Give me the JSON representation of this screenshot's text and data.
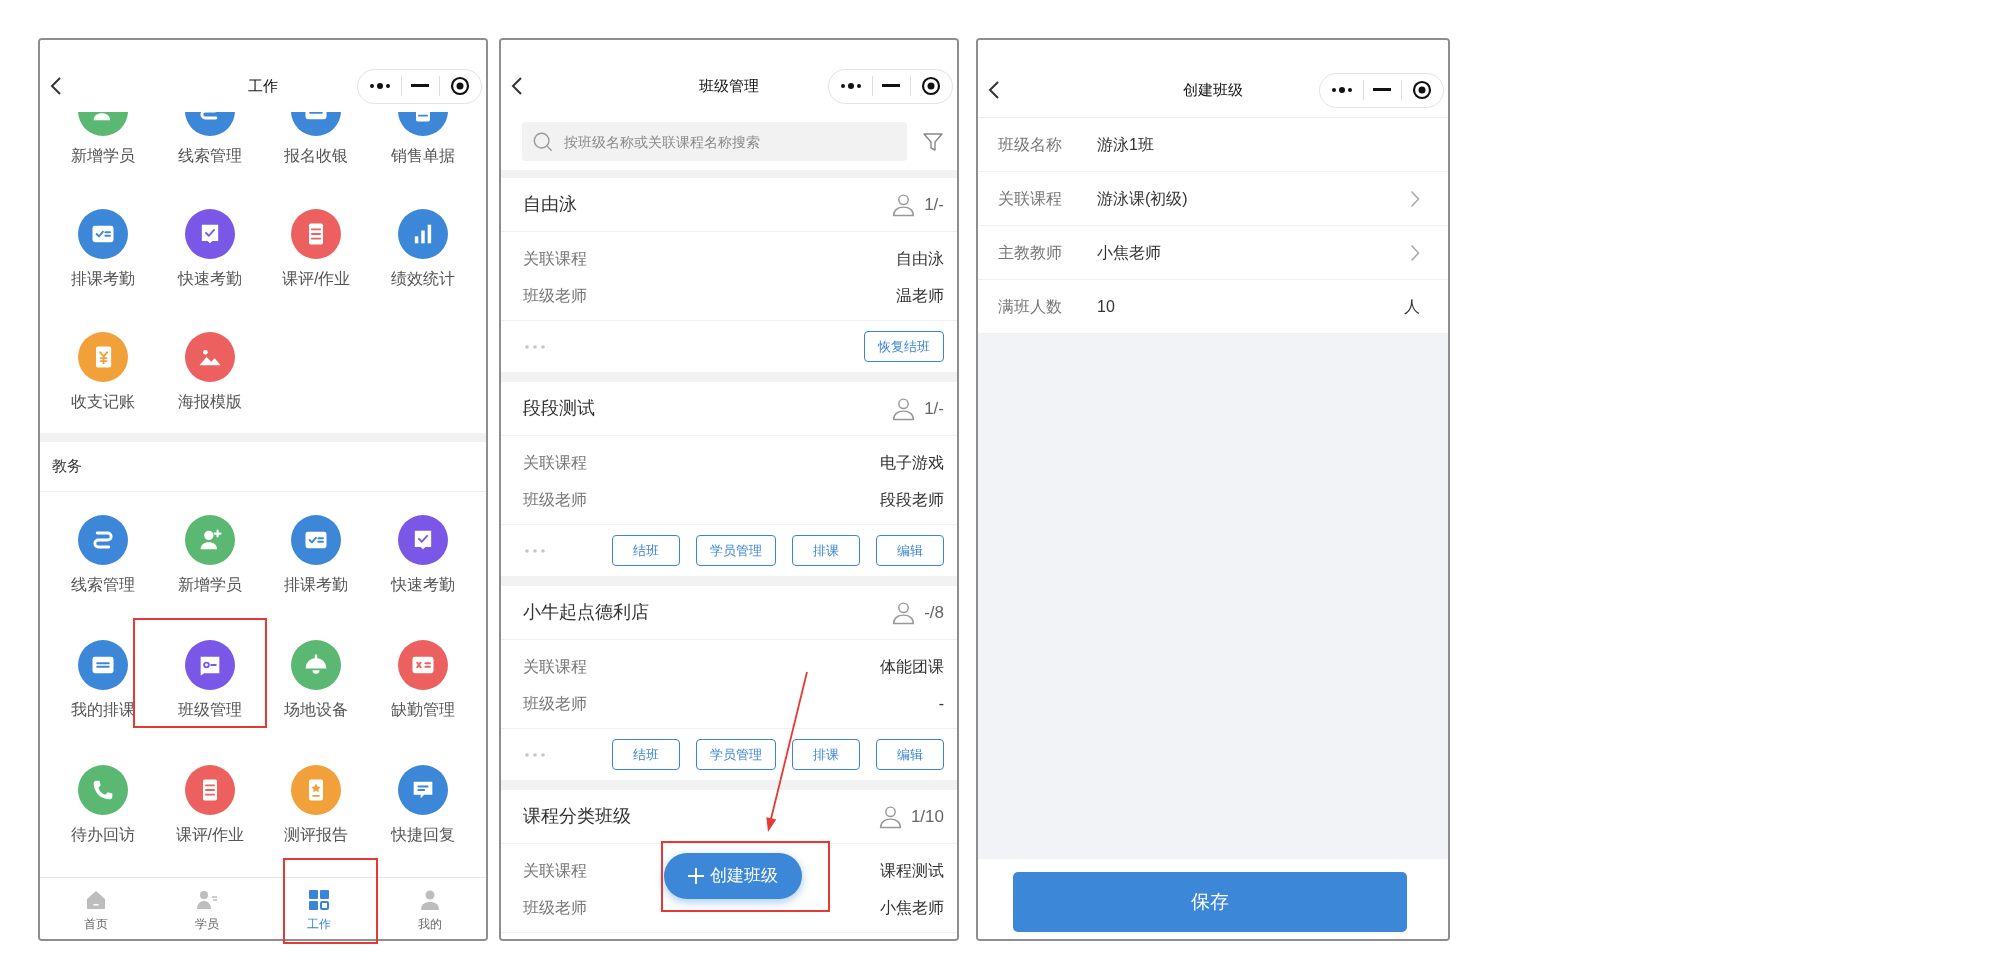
{
  "work_screen": {
    "title": "工作",
    "sections": [
      {
        "items": [
          {
            "label": "新增学员",
            "color": "#5bb872"
          },
          {
            "label": "线索管理",
            "color": "#3d87d9"
          },
          {
            "label": "报名收银",
            "color": "#3d87d9"
          },
          {
            "label": "销售单据",
            "color": "#3d87d9"
          },
          {
            "label": "排课考勤",
            "color": "#3d87d9"
          },
          {
            "label": "快速考勤",
            "color": "#7b57e8"
          },
          {
            "label": "课评/作业",
            "color": "#ec6160"
          },
          {
            "label": "绩效统计",
            "color": "#3d87d9"
          },
          {
            "label": "收支记账",
            "color": "#f2a03a"
          },
          {
            "label": "海报模版",
            "color": "#ec6160"
          }
        ]
      },
      {
        "title": "教务",
        "items": [
          {
            "label": "线索管理",
            "color": "#3d87d9"
          },
          {
            "label": "新增学员",
            "color": "#5bb872"
          },
          {
            "label": "排课考勤",
            "color": "#3d87d9"
          },
          {
            "label": "快速考勤",
            "color": "#7b57e8"
          },
          {
            "label": "我的排课",
            "color": "#3d87d9"
          },
          {
            "label": "班级管理",
            "color": "#7b57e8"
          },
          {
            "label": "场地设备",
            "color": "#5bb872"
          },
          {
            "label": "缺勤管理",
            "color": "#ec6160"
          },
          {
            "label": "待办回访",
            "color": "#5bb872"
          },
          {
            "label": "课评/作业",
            "color": "#ec6160"
          },
          {
            "label": "测评报告",
            "color": "#f2a03a"
          },
          {
            "label": "快捷回复",
            "color": "#3d87d9"
          }
        ]
      }
    ],
    "tab_bar": [
      {
        "label": "首页",
        "selected": false
      },
      {
        "label": "学员",
        "selected": false
      },
      {
        "label": "工作",
        "selected": true
      },
      {
        "label": "我的",
        "selected": false
      }
    ]
  },
  "class_screen": {
    "title": "班级管理",
    "search": {
      "placeholder": "按班级名称或关联课程名称搜索"
    },
    "classes": [
      {
        "name": "自由泳",
        "count": "1/-",
        "course_label": "关联课程",
        "course": "自由泳",
        "teacher_label": "班级老师",
        "teacher": "温老师",
        "actions": [
          "恢复结班"
        ]
      },
      {
        "name": "段段测试",
        "count": "1/-",
        "course_label": "关联课程",
        "course": "电子游戏",
        "teacher_label": "班级老师",
        "teacher": "段段老师",
        "actions": [
          "结班",
          "学员管理",
          "排课",
          "编辑"
        ]
      },
      {
        "name": "小牛起点德利店",
        "count": "-/8",
        "course_label": "关联课程",
        "course": "体能团课",
        "teacher_label": "班级老师",
        "teacher": "-",
        "actions": [
          "结班",
          "学员管理",
          "排课",
          "编辑"
        ]
      },
      {
        "name": "课程分类班级",
        "count": "1/10",
        "course_label": "关联课程",
        "course": "课程测试",
        "teacher_label": "班级老师",
        "teacher": "小焦老师"
      }
    ],
    "create_button": "创建班级"
  },
  "create_screen": {
    "title": "创建班级",
    "fields": [
      {
        "kind": "text",
        "label": "班级名称",
        "value": "游泳1班"
      },
      {
        "kind": "select",
        "label": "关联课程",
        "value": "游泳课(初级)"
      },
      {
        "kind": "select",
        "label": "主教教师",
        "value": "小焦老师"
      },
      {
        "kind": "number",
        "label": "满班人数",
        "value": "10",
        "unit": "人"
      }
    ],
    "save_button": "保存"
  }
}
